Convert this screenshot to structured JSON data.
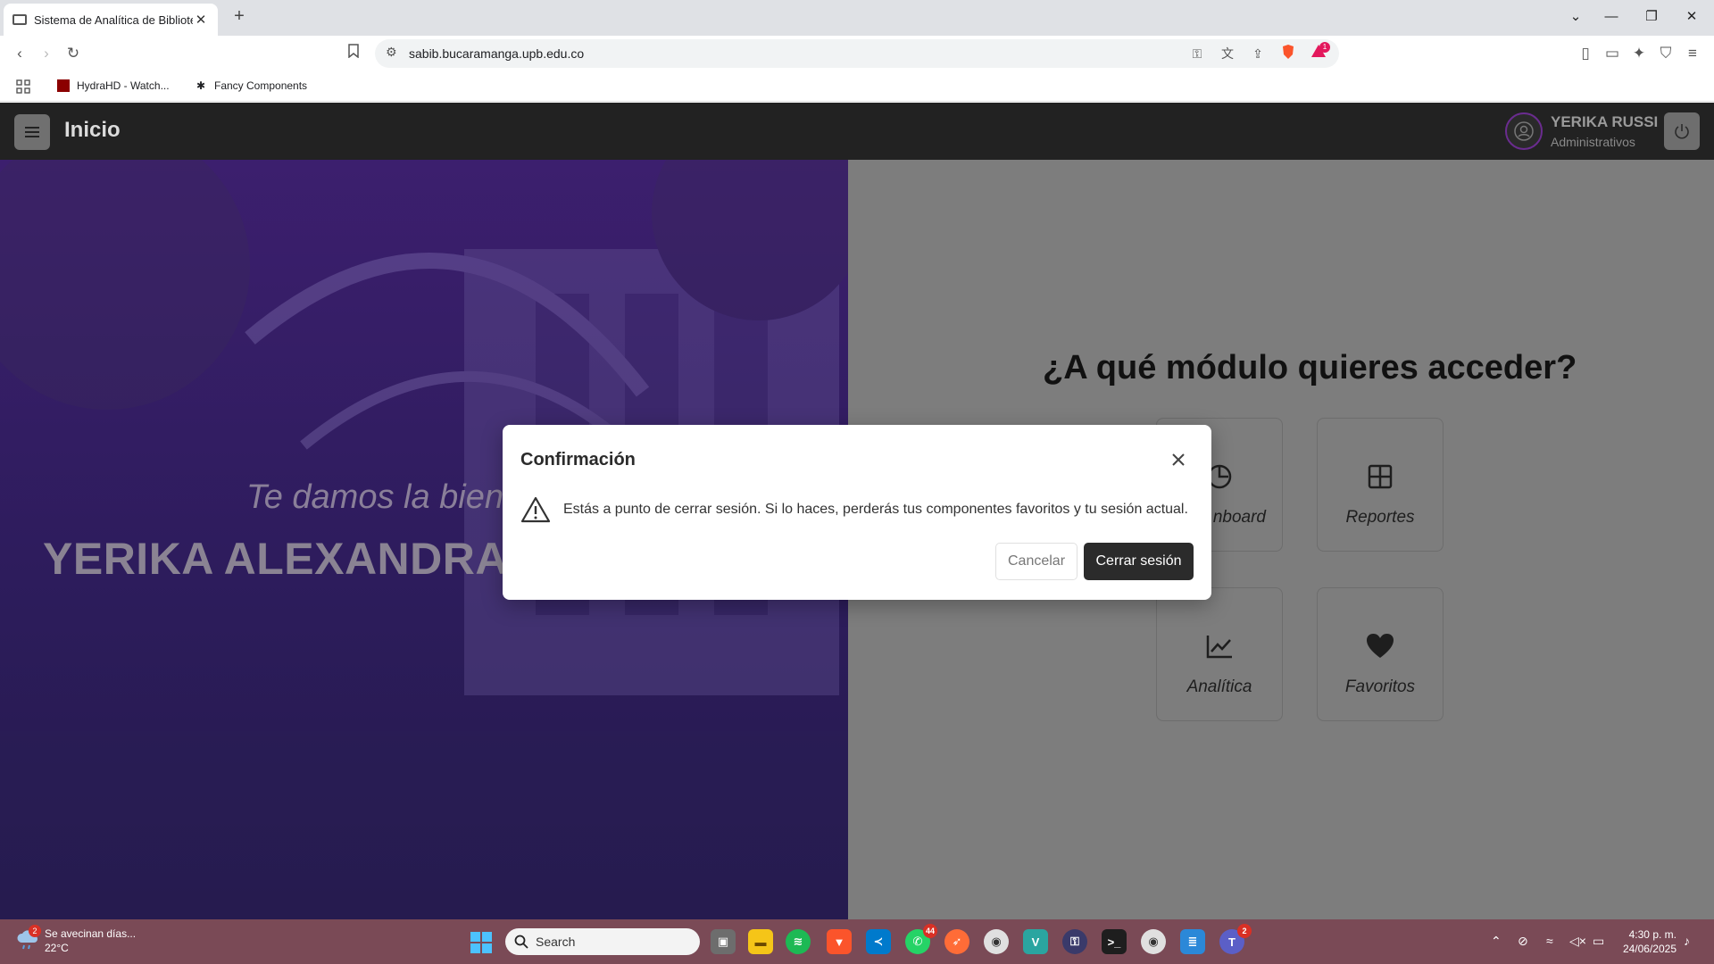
{
  "browser": {
    "tab_title": "Sistema de Analítica de Bibliotec",
    "url": "sabib.bucaramanga.upb.edu.co",
    "alerts_badge": "1",
    "bookmarks": [
      {
        "label": "HydraHD - Watch..."
      },
      {
        "label": "Fancy Components"
      }
    ]
  },
  "app": {
    "title": "Inicio",
    "user": {
      "name": "YERIKA RUSSI",
      "role": "Administrativos"
    }
  },
  "hero": {
    "welcome": "Te damos la bienv",
    "fullname": "YERIKA ALEXANDRA R"
  },
  "modules": {
    "question": "¿A qué módulo quieres acceder?",
    "cards": [
      {
        "label": "nboard",
        "icon": "dashboard-icon"
      },
      {
        "label": "Reportes",
        "icon": "grid-icon"
      },
      {
        "label": "Analítica",
        "icon": "chart-icon"
      },
      {
        "label": "Favoritos",
        "icon": "heart-icon"
      }
    ]
  },
  "modal": {
    "title": "Confirmación",
    "message": "Estás a punto de cerrar sesión. Si lo haces, perderás tus componentes favoritos y tu sesión actual.",
    "cancel": "Cancelar",
    "confirm": "Cerrar sesión"
  },
  "taskbar": {
    "weather_badge": "2",
    "weather_text": "Se avecinan días...",
    "temperature": "22°C",
    "search_placeholder": "Search",
    "whatsapp_badge": "44",
    "teams_badge": "2",
    "time": "4:30 p. m.",
    "date": "24/06/2025"
  },
  "colors": {
    "appbar": "#222222",
    "hero": "#3c1f6e",
    "taskbar": "#7a4a56",
    "primary_button": "#2b2b2b"
  }
}
